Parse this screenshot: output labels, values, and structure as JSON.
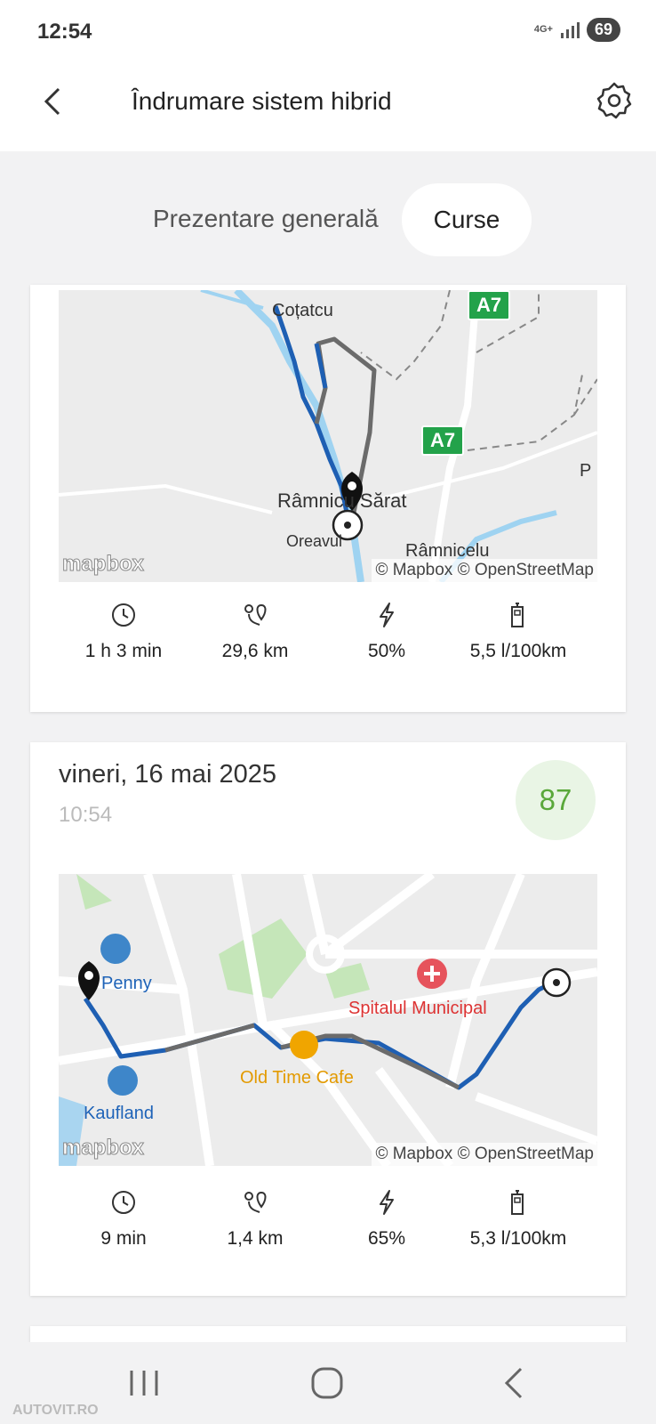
{
  "status": {
    "time": "12:54",
    "network": "4G+",
    "battery": "69"
  },
  "header": {
    "title": "Îndrumare sistem hibrid"
  },
  "tabs": [
    {
      "label": "Prezentare generală"
    },
    {
      "label": "Curse"
    }
  ],
  "trips": [
    {
      "map": {
        "places": [
          "Coțatcu",
          "Râmnicu Sărat",
          "Oreavul",
          "Râmnicelu",
          "P"
        ],
        "roads": [
          "A7",
          "A7"
        ],
        "attribution": "© Mapbox © OpenStreetMap",
        "logo": "mapbox"
      },
      "stats": {
        "duration": "1 h 3 min",
        "distance": "29,6 km",
        "electric": "50%",
        "consumption": "5,5 l/100km"
      }
    },
    {
      "date": "vineri, 16 mai 2025",
      "time": "10:54",
      "score": "87",
      "map": {
        "places": [
          "Penny",
          "Spitalul Municipal",
          "Old Time Cafe",
          "Kaufland"
        ],
        "attribution": "© Mapbox © OpenStreetMap",
        "logo": "mapbox"
      },
      "stats": {
        "duration": "9 min",
        "distance": "1,4 km",
        "electric": "65%",
        "consumption": "5,3 l/100km"
      }
    }
  ],
  "icons": {
    "duration": "clock-icon",
    "distance": "route-icon",
    "electric": "lightning-icon",
    "consumption": "fuel-pump-icon"
  },
  "colors": {
    "route_ev": "#1e5fb3",
    "route_fuel": "#6b6b6b",
    "score_bg": "#e9f5e5",
    "score_fg": "#5aa83a"
  },
  "watermark": "AUTOVIT.RO"
}
